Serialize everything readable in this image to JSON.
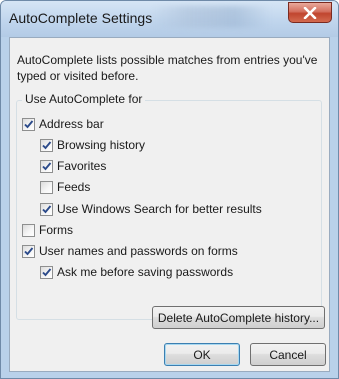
{
  "window": {
    "title": "AutoComplete Settings",
    "close_glyph": "X"
  },
  "description": "AutoComplete lists possible matches from entries you've typed or visited before.",
  "group": {
    "label": "Use AutoComplete for",
    "options": [
      {
        "label": "Address bar",
        "checked": true
      },
      {
        "label": "Browsing history",
        "checked": true
      },
      {
        "label": "Favorites",
        "checked": true
      },
      {
        "label": "Feeds",
        "checked": false
      },
      {
        "label": "Use Windows Search for better results",
        "checked": true
      },
      {
        "label": "Forms",
        "checked": false
      },
      {
        "label": "User names and passwords on forms",
        "checked": true
      },
      {
        "label": "Ask me before saving passwords",
        "checked": true
      }
    ]
  },
  "buttons": {
    "delete_history": "Delete AutoComplete history...",
    "ok": "OK",
    "cancel": "Cancel"
  },
  "colors": {
    "check": "#2b4a8a",
    "close_red": "#c0452f",
    "accent_border": "#3c7fb1"
  },
  "icons": {
    "close": "close-icon",
    "check": "checkmark-icon"
  }
}
